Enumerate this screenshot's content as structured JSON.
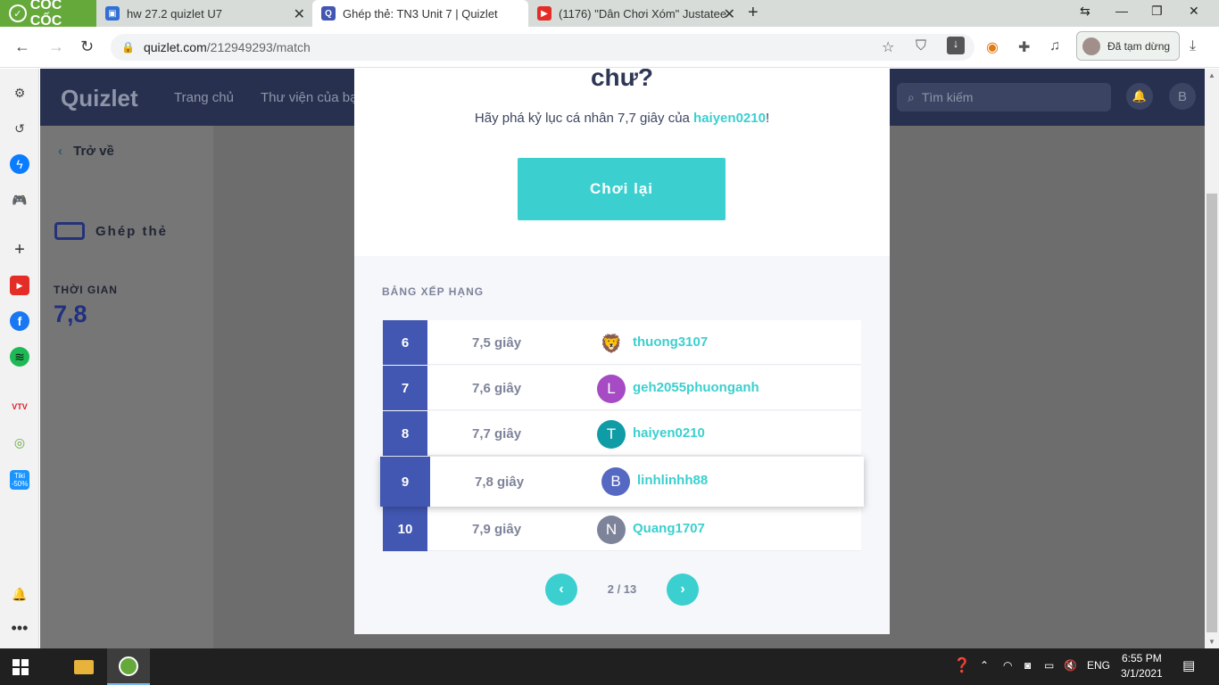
{
  "browser": {
    "brand": "CỐC CỐC",
    "tabs": [
      {
        "title": "hw 27.2 quizlet U7",
        "favicon_color": "#2f6fd6",
        "favicon_glyph": "▣"
      },
      {
        "title": "Ghép thẻ: TN3 Unit 7 | Quizlet",
        "favicon_color": "#4257b2",
        "favicon_glyph": "Q"
      },
      {
        "title": "(1176) \"Dân Chơi Xóm\" Justatee",
        "favicon_color": "#e52d27",
        "favicon_glyph": "▶"
      }
    ],
    "url_host": "quizlet.com",
    "url_path": "/212949293/match",
    "paused_label": "Đã tạm dừng"
  },
  "sidebar": {
    "icons": [
      "gear-icon",
      "history-icon",
      "messenger-icon",
      "gamepad-icon",
      "plus-icon",
      "youtube-icon",
      "facebook-icon",
      "spotify-icon",
      "vtv-icon",
      "coccoc-map-icon",
      "tiki-icon",
      "notification-bell-icon",
      "more-icon"
    ],
    "vtv_label": "VTV",
    "tiki_label": "Tiki",
    "tiki_badge": "-50%"
  },
  "quizlet": {
    "logo": "Quizlet",
    "nav": [
      "Trang chủ",
      "Thư viện của bạn"
    ],
    "search_placeholder": "Tìm kiếm",
    "avatar_letter": "B",
    "back_label": "Trở về",
    "mode_label": "Ghép thẻ",
    "time_label": "THỜI GIAN",
    "time_value": "7,8"
  },
  "modal": {
    "title": "chư?",
    "subtitle_prefix": "Hãy phá kỷ lục cá nhân 7,7 giây của ",
    "subtitle_user": "haiyen0210",
    "subtitle_suffix": "!",
    "replay_label": "Chơi lại",
    "leaderboard_title": "BẢNG XẾP HẠNG",
    "rows": [
      {
        "rank": "6",
        "time": "7,5 giây",
        "avatar": "🦁",
        "avatar_color": "#ffffff",
        "name": "thuong3107"
      },
      {
        "rank": "7",
        "time": "7,6 giây",
        "avatar": "L",
        "avatar_color": "#a64bc4",
        "name": "geh2055phuonganh"
      },
      {
        "rank": "8",
        "time": "7,7 giây",
        "avatar": "T",
        "avatar_color": "#0f9ca6",
        "name": "haiyen0210"
      },
      {
        "rank": "9",
        "time": "7,8 giây",
        "avatar": "B",
        "avatar_color": "#5568c2",
        "name": "linhlinhh88"
      },
      {
        "rank": "10",
        "time": "7,9 giây",
        "avatar": "N",
        "avatar_color": "#7d8399",
        "name": "Quang1707"
      }
    ],
    "pager_text": "2 / 13",
    "prev_glyph": "‹",
    "next_glyph": "›"
  },
  "taskbar": {
    "lang": "ENG",
    "time": "6:55 PM",
    "date": "3/1/2021"
  }
}
